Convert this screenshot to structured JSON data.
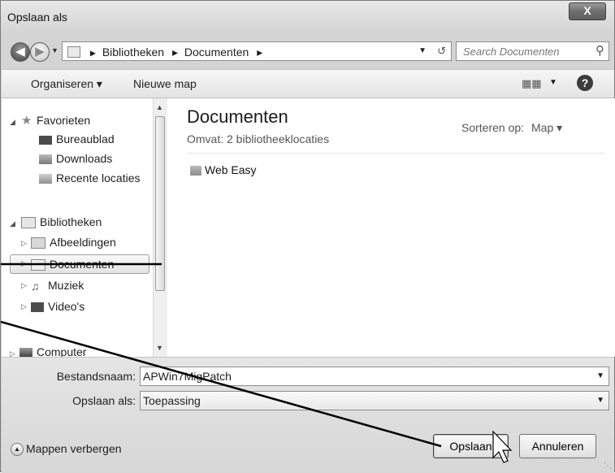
{
  "window": {
    "title": "Opslaan als",
    "close_label": "X"
  },
  "navigation": {
    "breadcrumb": [
      "Bibliotheken",
      "Documenten"
    ],
    "separator": "▸",
    "search_placeholder": "Search Documenten"
  },
  "toolbar": {
    "organize": "Organiseren ▾",
    "new_folder": "Nieuwe map",
    "help": "?"
  },
  "sidebar": {
    "favorites": {
      "label": "Favorieten",
      "items": [
        "Bureaublad",
        "Downloads",
        "Recente locaties"
      ]
    },
    "libraries": {
      "label": "Bibliotheken",
      "items": [
        "Afbeeldingen",
        "Documenten",
        "Muziek",
        "Video's"
      ],
      "selected": "Documenten"
    },
    "computer": "Computer"
  },
  "main": {
    "title": "Documenten",
    "subtitle": "Omvat: 2 bibliotheeklocaties",
    "sort_label": "Sorteren op:",
    "sort_value": "Map ▾",
    "files": [
      "Web Easy"
    ]
  },
  "footer": {
    "filename_label": "Bestandsnaam:",
    "filename_value": "APWin7MigPatch",
    "type_label": "Opslaan als:",
    "type_value": "Toepassing",
    "hide_folders": "Mappen verbergen",
    "save": "Opslaan",
    "cancel": "Annuleren"
  },
  "colors": {
    "accent": "#d4d4d4",
    "selection": "#e3e3e3"
  }
}
